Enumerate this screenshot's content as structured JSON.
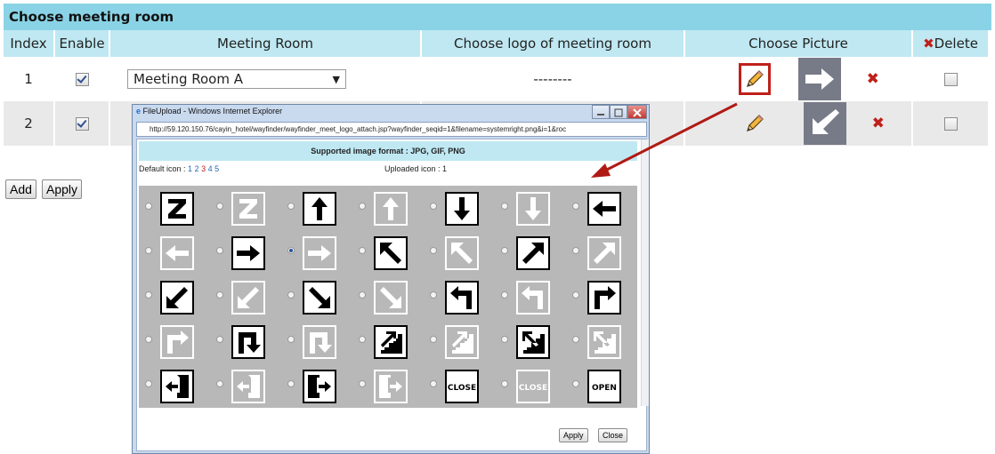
{
  "panel": {
    "title": "Choose meeting room",
    "columns": [
      "Index",
      "Enable",
      "Meeting Room",
      "Choose logo of meeting room",
      "Choose Picture",
      "Delete"
    ],
    "rows": [
      {
        "index": "1",
        "enabled": true,
        "room": "Meeting Room A",
        "logo": "--------",
        "picture": "arrow-right"
      },
      {
        "index": "2",
        "enabled": true,
        "room": "",
        "logo": "",
        "picture": "arrow-down-left"
      }
    ],
    "add_label": "Add",
    "apply_label": "Apply"
  },
  "popup": {
    "window_title": "FileUpload - Windows Internet Explorer",
    "address": "http://59.120.150.76/cayin_hotel/wayfinder/wayfinder_meet_logo_attach.jsp?wayfinder_seqid=1&filename=systemright.png&i=1&roc",
    "format_text": "Supported image format : JPG, GIF, PNG",
    "default_icon_label": "Default icon :",
    "pages": [
      "1",
      "2",
      "3",
      "4",
      "5"
    ],
    "active_page": "3",
    "uploaded_label": "Uploaded icon : 1",
    "apply_label": "Apply",
    "close_label": "Close",
    "selected_icon": "arrow-right-white",
    "icons": [
      [
        "z-black",
        "z-white",
        "arrow-up-black",
        "arrow-up-white",
        "arrow-down-black",
        "arrow-down-white",
        "arrow-left-black"
      ],
      [
        "arrow-left-white",
        "arrow-right-black",
        "arrow-right-white",
        "arrow-up-left-black",
        "arrow-up-left-white",
        "arrow-up-right-black",
        "arrow-up-right-white"
      ],
      [
        "arrow-down-left-black",
        "arrow-down-left-white",
        "arrow-down-right-black",
        "arrow-down-right-white",
        "turn-left-black",
        "turn-left-white",
        "turn-right-black"
      ],
      [
        "turn-right-white",
        "u-turn-black",
        "u-turn-white",
        "stairs-up-black",
        "stairs-up-white",
        "stairs-down-black",
        "stairs-down-white"
      ],
      [
        "exit-left-black",
        "exit-left-white",
        "exit-right-black",
        "exit-right-white",
        "close-black",
        "close-white",
        "open-black"
      ]
    ],
    "close_sign_text": "CLOSE",
    "open_sign_text": "OPEN"
  },
  "colors": {
    "header": "#8ad3e6",
    "subheader": "#bfe8f2",
    "highlight": "#c0201a",
    "grid_bg": "#b8b8b8"
  }
}
